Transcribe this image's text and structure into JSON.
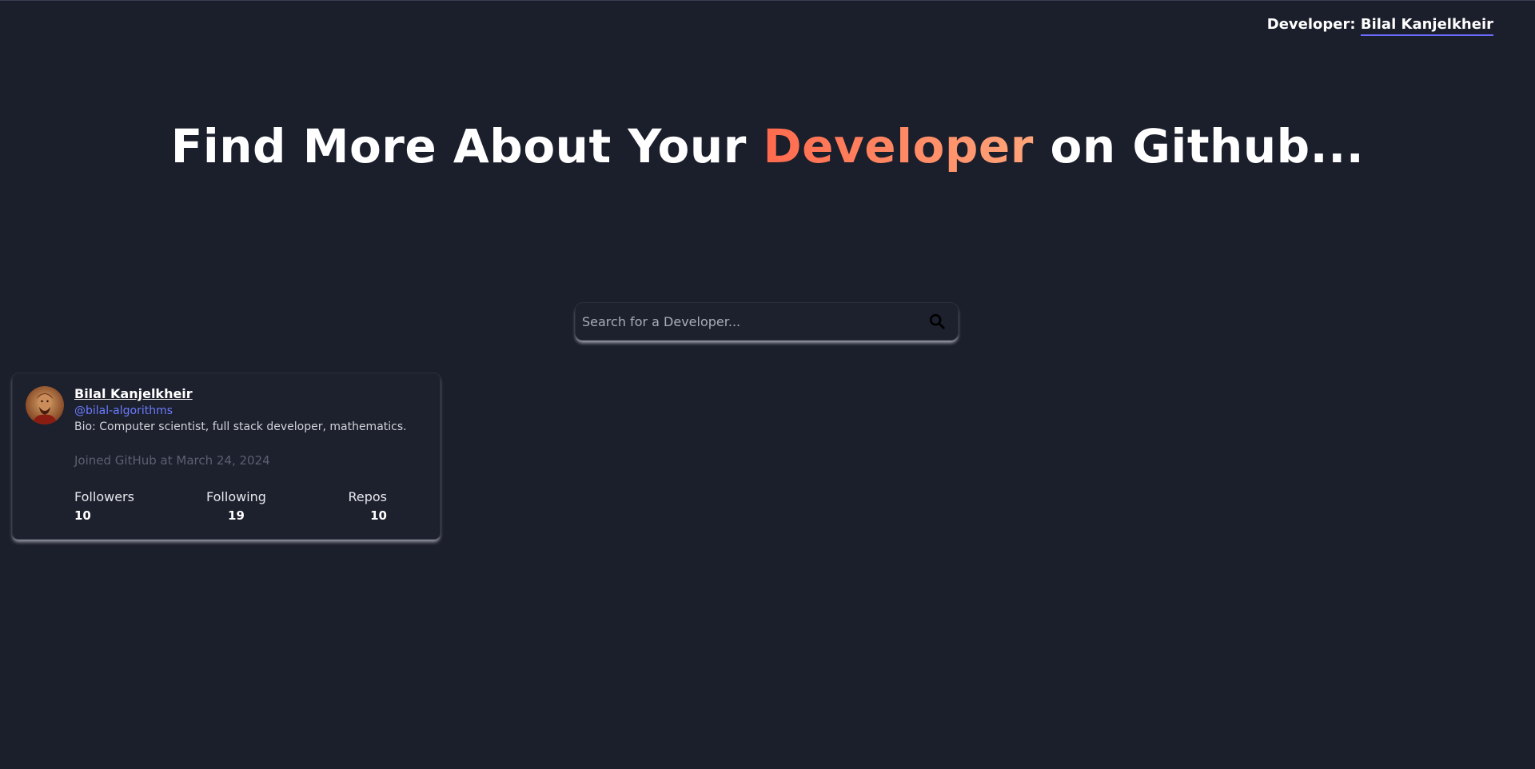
{
  "header": {
    "credit_prefix": "Developer:",
    "credit_name": "Bilal Kanjelkheir"
  },
  "hero": {
    "before": "Find More About Your",
    "accent": "Developer",
    "after": "on Github..."
  },
  "search": {
    "placeholder": "Search for a Developer...",
    "value": "",
    "icon": "search-icon"
  },
  "profile": {
    "name": "Bilal Kanjelkheir",
    "handle": "@bilal-algorithms",
    "bio": "Bio: Computer scientist, full stack developer, mathematics.",
    "joined": "Joined GitHub at March 24, 2024",
    "stats": {
      "followers_label": "Followers",
      "followers": "10",
      "following_label": "Following",
      "following": "19",
      "repos_label": "Repos",
      "repos": "10"
    }
  },
  "colors": {
    "background": "#1b1e2b",
    "accent_start": "#ff6a4d",
    "accent_end": "#ffa57a",
    "link": "#6b7cff",
    "underline": "#6b6cff"
  }
}
